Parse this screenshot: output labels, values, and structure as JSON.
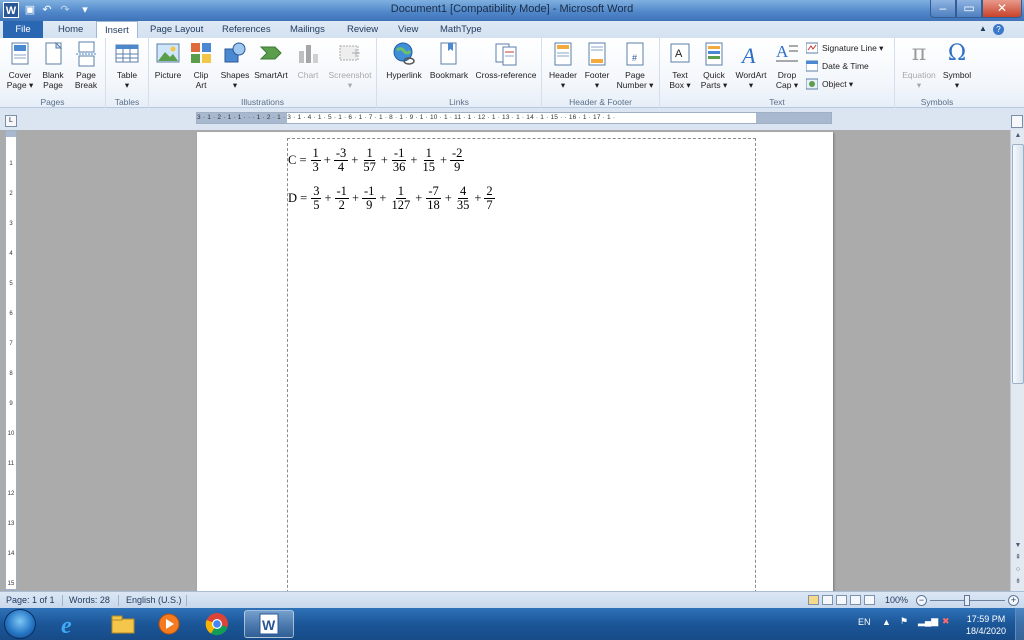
{
  "window": {
    "title": "Document1 [Compatibility Mode]  -  Microsoft Word",
    "app_logo": "W",
    "quick_access": [
      "save-icon",
      "undo-icon",
      "redo-icon",
      "customize-icon"
    ]
  },
  "tabs": [
    "File",
    "Home",
    "Insert",
    "Page Layout",
    "References",
    "Mailings",
    "Review",
    "View",
    "MathType"
  ],
  "active_tab": "Insert",
  "ribbon": {
    "groups": [
      {
        "label": "Pages",
        "buttons": [
          {
            "l1": "Cover",
            "l2": "Page ▾"
          },
          {
            "l1": "Blank",
            "l2": "Page"
          },
          {
            "l1": "Page",
            "l2": "Break"
          }
        ]
      },
      {
        "label": "Tables",
        "buttons": [
          {
            "l1": "Table",
            "l2": "▾"
          }
        ]
      },
      {
        "label": "Illustrations",
        "buttons": [
          {
            "l1": "Picture",
            "l2": ""
          },
          {
            "l1": "Clip",
            "l2": "Art"
          },
          {
            "l1": "Shapes",
            "l2": "▾"
          },
          {
            "l1": "SmartArt",
            "l2": ""
          },
          {
            "l1": "Chart",
            "l2": ""
          },
          {
            "l1": "Screenshot",
            "l2": "▾"
          }
        ]
      },
      {
        "label": "Links",
        "buttons": [
          {
            "l1": "Hyperlink",
            "l2": ""
          },
          {
            "l1": "Bookmark",
            "l2": ""
          },
          {
            "l1": "Cross-reference",
            "l2": ""
          }
        ]
      },
      {
        "label": "Header & Footer",
        "buttons": [
          {
            "l1": "Header",
            "l2": "▾"
          },
          {
            "l1": "Footer",
            "l2": "▾"
          },
          {
            "l1": "Page",
            "l2": "Number ▾"
          }
        ]
      },
      {
        "label": "Text",
        "buttons": [
          {
            "l1": "Text",
            "l2": "Box ▾"
          },
          {
            "l1": "Quick",
            "l2": "Parts ▾"
          },
          {
            "l1": "WordArt",
            "l2": "▾"
          },
          {
            "l1": "Drop",
            "l2": "Cap ▾"
          }
        ],
        "small": [
          "Signature Line ▾",
          "Date & Time",
          "Object ▾"
        ]
      },
      {
        "label": "Symbols",
        "buttons": [
          {
            "l1": "Equation",
            "l2": "▾"
          },
          {
            "l1": "Symbol",
            "l2": "▾"
          }
        ]
      }
    ]
  },
  "ruler": {
    "h_text": "3 · 1 · 2 · 1 · 1 ·  ·  · 1 · 2 · 1 · 3 · 1 · 4 · 1 · 5 · 1 · 6 · 1 · 7 · 1 · 8 · 1 · 9 · 1 · 10 · 1 · 11 · 1 · 12 · 1 · 13 · 1 · 14 · 1 · 15 ·  · 16 · 1 · 17 · 1 ·",
    "v_ticks": [
      "1",
      "2",
      "3",
      "4",
      "5",
      "6",
      "7",
      "8",
      "9",
      "10",
      "11",
      "12",
      "13",
      "14",
      "15"
    ]
  },
  "document": {
    "equations": [
      {
        "lhs": "C =",
        "terms": [
          {
            "op": "",
            "num": "1",
            "den": "3"
          },
          {
            "op": "+",
            "num": "-3",
            "den": "4"
          },
          {
            "op": "+",
            "num": "1",
            "den": "57"
          },
          {
            "op": "+",
            "num": "-1",
            "den": "36"
          },
          {
            "op": "+",
            "num": "1",
            "den": "15"
          },
          {
            "op": "+",
            "num": "-2",
            "den": "9"
          }
        ]
      },
      {
        "lhs": "D =",
        "terms": [
          {
            "op": "",
            "num": "3",
            "den": "5"
          },
          {
            "op": "+",
            "num": "-1",
            "den": "2"
          },
          {
            "op": "+",
            "num": "-1",
            "den": "9"
          },
          {
            "op": "+",
            "num": "1",
            "den": "127"
          },
          {
            "op": "+",
            "num": "-7",
            "den": "18"
          },
          {
            "op": "+",
            "num": "4",
            "den": "35"
          },
          {
            "op": "+",
            "num": "2",
            "den": "7"
          }
        ]
      }
    ]
  },
  "status": {
    "page": "Page: 1 of 1",
    "words": "Words: 28",
    "language": "English (U.S.)",
    "zoom": "100%",
    "zoom_minus": "−",
    "zoom_plus": "+"
  },
  "taskbar": {
    "apps": [
      "internet-explorer-icon",
      "file-explorer-icon",
      "media-player-icon",
      "chrome-icon",
      "word-icon"
    ],
    "lang": "EN",
    "time": "17:59 PM",
    "date": "18/4/2020"
  },
  "colors": {
    "accent": "#2a67b3",
    "titlebar": "#4f86c9",
    "taskbar": "#1b5698"
  }
}
